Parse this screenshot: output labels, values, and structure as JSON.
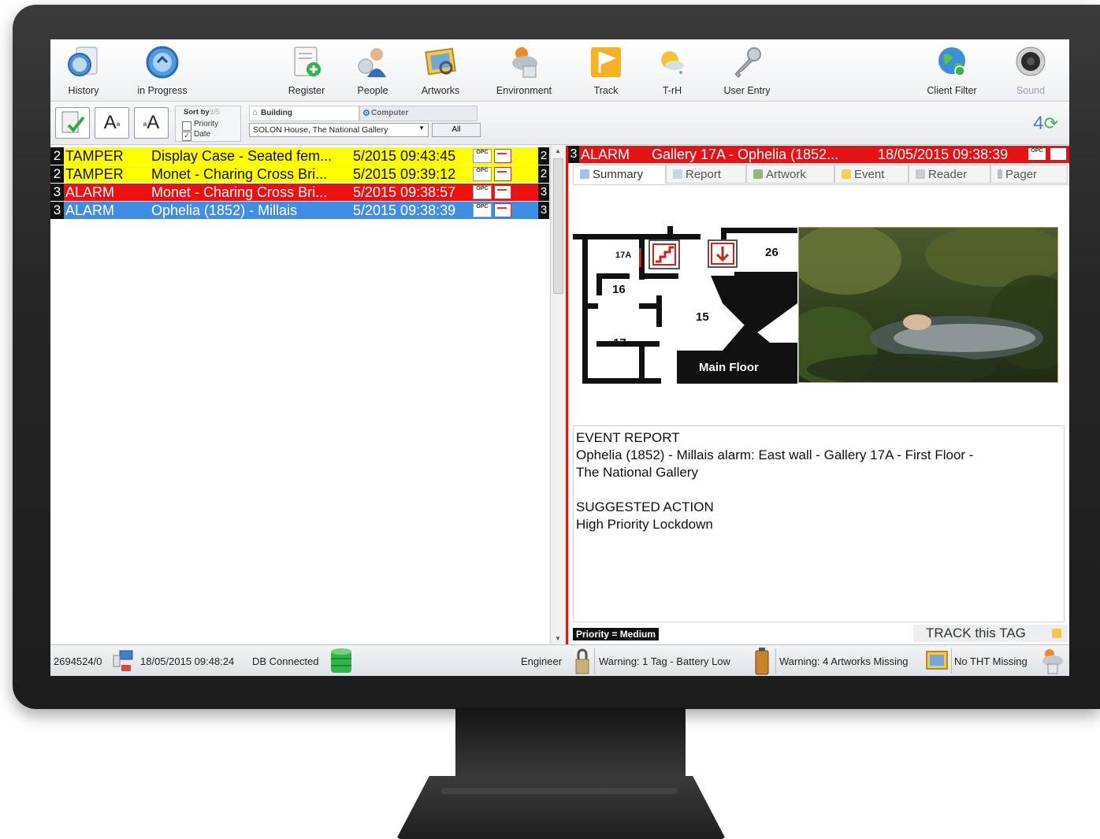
{
  "toolbar": {
    "items": [
      {
        "label": "History",
        "icon": "history-icon"
      },
      {
        "label": "in Progress",
        "icon": "progress-icon"
      },
      {
        "label": "Register",
        "icon": "register-icon"
      },
      {
        "label": "People",
        "icon": "people-icon"
      },
      {
        "label": "Artworks",
        "icon": "artworks-icon"
      },
      {
        "label": "Environment",
        "icon": "environment-icon"
      },
      {
        "label": "Track",
        "icon": "track-flag-icon"
      },
      {
        "label": "T-rH",
        "icon": "temperature-humidity-icon"
      },
      {
        "label": "User Entry",
        "icon": "key-icon"
      },
      {
        "label": "Client Filter",
        "icon": "globe-icon"
      },
      {
        "label": "Sound",
        "icon": "speaker-icon"
      }
    ]
  },
  "subbar": {
    "sort_title": "Sort by",
    "sort_faded": "3/5",
    "sort_options": [
      {
        "label": "Priority",
        "checked": false
      },
      {
        "label": "Date",
        "checked": true
      }
    ],
    "location_tabs": [
      "Building",
      "Computer"
    ],
    "location_value": "SOLON House, The National Gallery",
    "location_all": "All",
    "counter": "4"
  },
  "events": [
    {
      "priority": "2",
      "type": "TAMPER",
      "desc": "Display Case - Seated fem...",
      "time": "5/2015 09:43:45",
      "badge": "OPC",
      "color": "#ffff00",
      "text": "#111111"
    },
    {
      "priority": "2",
      "type": "TAMPER",
      "desc": "Monet - Charing Cross Bri...",
      "time": "5/2015 09:39:12",
      "badge": "OPC",
      "color": "#ffff00",
      "text": "#111111"
    },
    {
      "priority": "3",
      "type": "ALARM",
      "desc": "Monet - Charing Cross Bri...",
      "time": "5/2015 09:38:57",
      "badge": "OPC",
      "color": "#ee1111",
      "text": "#ffffff"
    },
    {
      "priority": "3",
      "type": "ALARM",
      "desc": "Ophelia (1852) - Millais",
      "time": "5/2015 09:38:39",
      "badge": "OPC",
      "color": "#3f8ee6",
      "text": "#ffffff"
    }
  ],
  "right_strip": [
    "2",
    "2",
    "3",
    "3"
  ],
  "detail": {
    "priority": "3",
    "type": "ALARM",
    "desc": "Gallery 17A -  Ophelia (1852...",
    "time": "18/05/2015 09:38:39",
    "badge": "OPC",
    "tabs": [
      "Summary",
      "Report",
      "Artwork",
      "Event",
      "Reader",
      "Pager"
    ],
    "floor": {
      "rooms": [
        "17A",
        "26",
        "16",
        "15",
        "17"
      ],
      "label": "Main Floor"
    },
    "report_lines": [
      "EVENT REPORT",
      "Ophelia (1852) - Millais alarm: East wall - Gallery 17A - First Floor -",
      "The National Gallery",
      "",
      "SUGGESTED ACTION",
      "High Priority Lockdown"
    ],
    "priority_label": "Priority = Medium",
    "track_label": "TRACK this TAG"
  },
  "status": {
    "id": "2694524/0",
    "datetime": "18/05/2015 09:48:24",
    "db": "DB Connected",
    "user": "Engineer",
    "warning1": "Warning: 1 Tag - Battery Low",
    "warning2": "Warning: 4 Artworks Missing",
    "warning3": "No THT Missing"
  }
}
